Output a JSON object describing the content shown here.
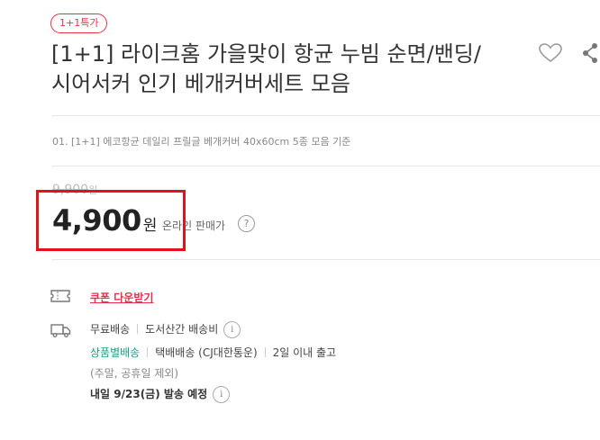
{
  "product": {
    "badge": "1+1특가",
    "title_line1": "[1+1] 라이크홈 가을맞이 항균 누빔 순면/밴딩/",
    "title_line2": "시어서커 인기 베개커버세트 모음",
    "option_text": "01. [1+1] 에코항균 데일리 프릴글 베개커버 40x60cm 5종 모음 기준"
  },
  "price": {
    "original": "9,900",
    "original_unit": "원",
    "sale": "4,900",
    "sale_unit": "원",
    "online_label": "온라인 판매가",
    "help_icon": "?"
  },
  "coupon": {
    "label": "쿠폰 다운받기",
    "icon": "ticket-icon"
  },
  "shipping": {
    "icon": "truck-icon",
    "free": "무료배송",
    "remote_fee": "도서산간 배송비",
    "by_product": "상품별배송",
    "courier": "택배배송 (CJ대한통운)",
    "lead_time": "2일 이내 출고",
    "note": "(주말, 공휴일 제외)",
    "dispatch": "내일 9/23(금) 발송 예정",
    "info_icon": "i"
  },
  "colors": {
    "accent_red": "#e8304a",
    "highlight_box": "#e3111c",
    "green": "#16a085"
  }
}
